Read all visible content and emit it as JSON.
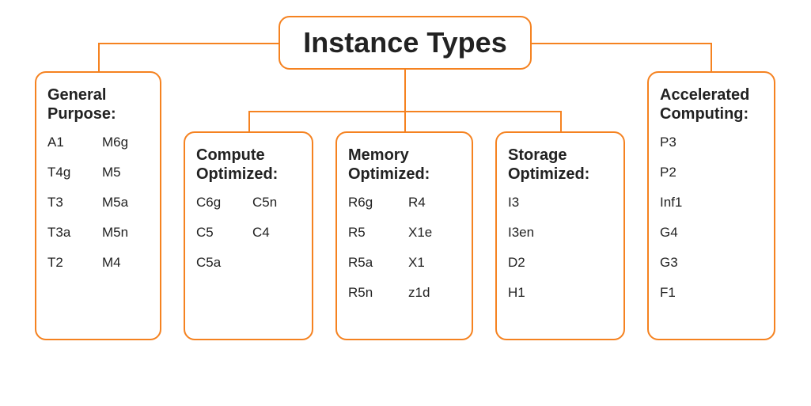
{
  "root": {
    "title": "Instance Types"
  },
  "categories": [
    {
      "title": "General Purpose:",
      "layout": "grid2",
      "items": [
        "A1",
        "M6g",
        "T4g",
        "M5",
        "T3",
        "M5a",
        "T3a",
        "M5n",
        "T2",
        "M4"
      ]
    },
    {
      "title": "Compute Optimized:",
      "layout": "grid2",
      "items": [
        "C6g",
        "C5n",
        "C5",
        "C4",
        "C5a"
      ]
    },
    {
      "title": "Memory Optimized:",
      "layout": "grid2",
      "items": [
        "R6g",
        "R4",
        "R5",
        "X1e",
        "R5a",
        "X1",
        "R5n",
        "z1d"
      ]
    },
    {
      "title": "Storage Optimized:",
      "layout": "col1",
      "items": [
        "I3",
        "I3en",
        "D2",
        "H1"
      ]
    },
    {
      "title": "Accelerated Computing:",
      "layout": "col1",
      "items": [
        "P3",
        "P2",
        "Inf1",
        "G4",
        "G3",
        "F1"
      ]
    }
  ],
  "colors": {
    "accent": "#f58220"
  }
}
